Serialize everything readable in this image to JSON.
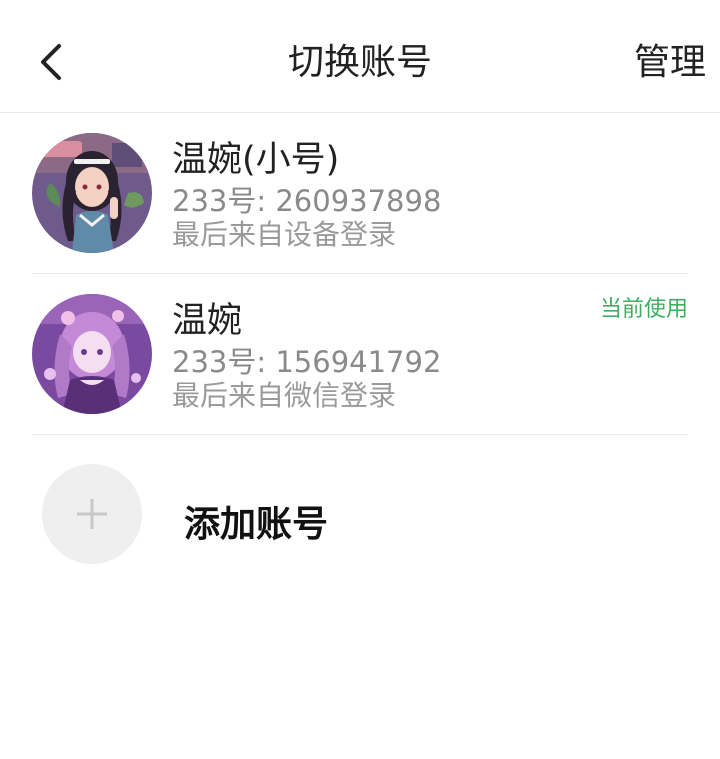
{
  "header": {
    "title": "切换账号",
    "manage_label": "管理",
    "back_icon": "chevron-left-icon"
  },
  "accounts": [
    {
      "name": "温婉(小号)",
      "id_text": "233号: 260937898",
      "login_text": "最后来自设备登录",
      "current": ""
    },
    {
      "name": "温婉",
      "id_text": "233号: 156941792",
      "login_text": "最后来自微信登录",
      "current": "当前使用"
    }
  ],
  "add": {
    "label": "添加账号",
    "icon": "plus-icon"
  },
  "colors": {
    "accent_green": "#3fae62",
    "secondary_text": "#8a8a8a",
    "divider": "#ebebeb"
  }
}
